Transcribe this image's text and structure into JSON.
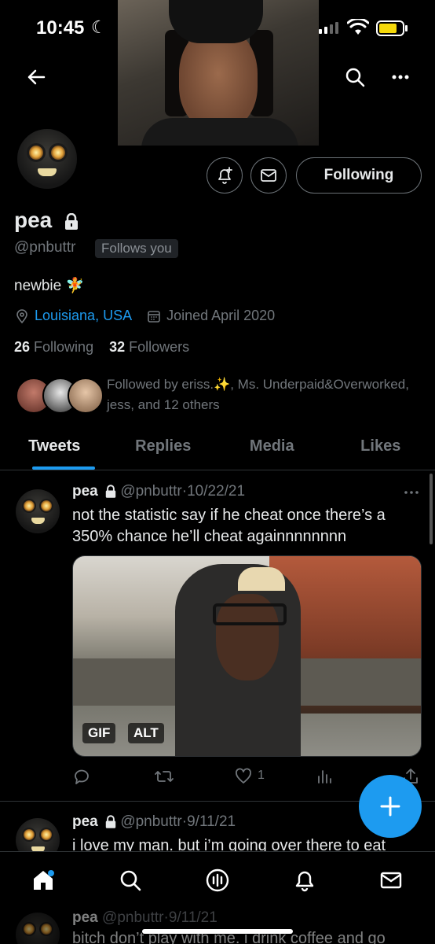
{
  "status_bar": {
    "time": "10:45"
  },
  "profile": {
    "name": "pea",
    "handle": "@pnbuttr",
    "follows_you": "Follows you",
    "bio": "newbie",
    "bio_emoji": "🧚",
    "location": "Louisiana, USA",
    "joined": "Joined April 2020",
    "following_count": "26",
    "following_label": "Following",
    "followers_count": "32",
    "followers_label": "Followers",
    "followed_by": "Followed by eriss.✨, Ms. Underpaid&Overworked, jess, and 12 others",
    "follow_button": "Following"
  },
  "tabs": [
    {
      "label": "Tweets",
      "active": true
    },
    {
      "label": "Replies",
      "active": false
    },
    {
      "label": "Media",
      "active": false
    },
    {
      "label": "Likes",
      "active": false
    }
  ],
  "tweets": [
    {
      "name": "pea",
      "handle": "@pnbuttr",
      "date": "10/22/21",
      "text": "not the statistic say if he cheat once there’s a 350% chance he’ll cheat againnnnnnnn",
      "media_badges": [
        "GIF",
        "ALT"
      ],
      "likes": "1"
    },
    {
      "name": "pea",
      "handle": "@pnbuttr",
      "date": "9/11/21",
      "text": "i love my man. but i’m going over there to eat"
    },
    {
      "name": "pea",
      "handle": "@pnbuttr",
      "date": "9/11/21",
      "text": "bitch don’t play with me. i drink coffee and go"
    }
  ],
  "colors": {
    "accent": "#1d9bf0",
    "background": "#000000",
    "muted": "#71767b"
  },
  "icons": {
    "back": "back-arrow-icon",
    "search": "search-icon",
    "more": "more-icon",
    "notify": "bell-plus-icon",
    "message": "envelope-icon",
    "nav": [
      "home-icon",
      "search-icon",
      "spaces-icon",
      "bell-icon",
      "envelope-icon"
    ]
  }
}
